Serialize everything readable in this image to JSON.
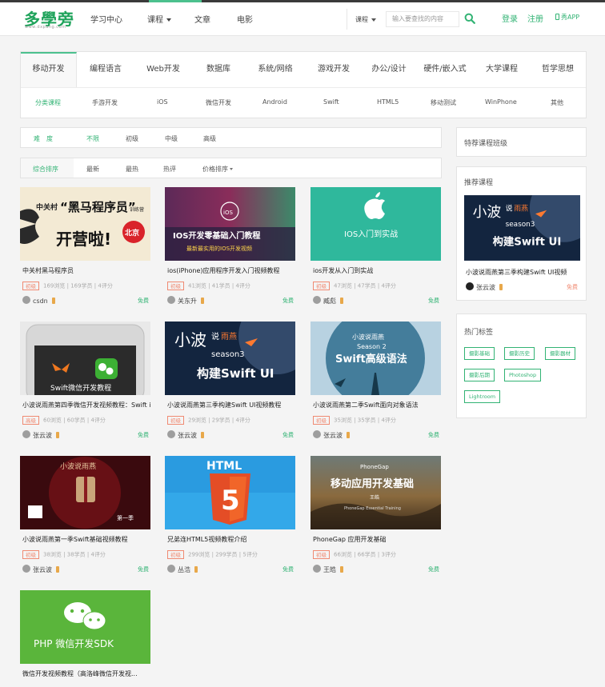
{
  "logo": {
    "text": "多學旁",
    "sub": "www.dxpang.com"
  },
  "nav": {
    "study": "学习中心",
    "course": "课程",
    "article": "文章",
    "movie": "电影"
  },
  "search": {
    "select": "课程",
    "placeholder": "输入要查找的内容"
  },
  "auth": {
    "login": "登录",
    "register": "注册",
    "app": "秀APP"
  },
  "categories": [
    "移动开发",
    "编程语言",
    "Web开发",
    "数据库",
    "系统/网络",
    "游戏开发",
    "办公/设计",
    "硬件/嵌入式",
    "大学课程",
    "哲学思想"
  ],
  "subcategories": [
    "分类课程",
    "手游开发",
    "iOS",
    "微信开发",
    "Android",
    "Swift",
    "HTML5",
    "移动测试",
    "WinPhone",
    "其他"
  ],
  "difficulty": {
    "label": "难　度",
    "options": [
      "不限",
      "初级",
      "中级",
      "高级"
    ]
  },
  "sorting": {
    "options": [
      "综合排序",
      "最新",
      "最热",
      "热评",
      "价格排序"
    ]
  },
  "courses": [
    {
      "title": "中关村黑马程序员",
      "level": "初级",
      "views": "169浏览",
      "students": "169学员",
      "ratings": "4评分",
      "author": "csdn",
      "price": "免费",
      "thumb": {
        "top": "中关村",
        "main": "“黑马程序员”",
        "tag": "训练营",
        "big": "开营啦!",
        "city": "北京"
      }
    },
    {
      "title": "ios(iPhone)应用程序开发入门视频教程",
      "level": "初级",
      "views": "41浏览",
      "students": "41学员",
      "ratings": "4评分",
      "author": "关东升",
      "price": "免费",
      "thumb": {
        "badge": "iOS",
        "main": "IOS开发零基础入门教程",
        "sub": "最新最实用的IOS开发视频"
      }
    },
    {
      "title": "ios开发从入门到实战",
      "level": "初级",
      "views": "47浏览",
      "students": "47学员",
      "ratings": "4评分",
      "author": "臧彪",
      "price": "免费",
      "thumb": {
        "main": "IOS入门到实战"
      }
    },
    {
      "title": "小波说雨燕第四季微信开发视频教程：Swift iP...",
      "level": "高级",
      "views": "60浏览",
      "students": "60学员",
      "ratings": "4评分",
      "author": "张云波",
      "price": "免费",
      "thumb": {
        "main": "Swift微信开发教程"
      }
    },
    {
      "title": "小波说雨燕第三季构建Swift UI视频教程",
      "level": "初级",
      "views": "29浏览",
      "students": "29学员",
      "ratings": "4评分",
      "author": "张云波",
      "price": "免费",
      "thumb": {
        "brand1": "小波",
        "brand2": "说",
        "brand3": "雨燕",
        "season": "season3",
        "main": "构建Swift UI"
      }
    },
    {
      "title": "小波说雨燕第二季Swift面向对象语法",
      "level": "初级",
      "views": "35浏览",
      "students": "35学员",
      "ratings": "4评分",
      "author": "张云波",
      "price": "免费",
      "thumb": {
        "top": "小波说雨燕",
        "season": "Season 2",
        "main": "Swift高级语法"
      }
    },
    {
      "title": "小波说雨燕第一季Swift基础视频教程",
      "level": "初级",
      "views": "38浏览",
      "students": "38学员",
      "ratings": "4评分",
      "author": "张云波",
      "price": "免费",
      "thumb": {
        "top": "小波说雨燕",
        "corner": "第一季"
      }
    },
    {
      "title": "兄弟连HTML5视频教程介绍",
      "level": "初级",
      "views": "299浏览",
      "students": "299学员",
      "ratings": "5评分",
      "author": "丛浩",
      "price": "免费",
      "thumb": {
        "top": "HTML",
        "num": "5"
      }
    },
    {
      "title": "PhoneGap 应用开发基础",
      "level": "初级",
      "views": "66浏览",
      "students": "66学员",
      "ratings": "3评分",
      "author": "王皓",
      "price": "免费",
      "thumb": {
        "top": "PhoneGap",
        "main": "移动应用开发基础",
        "author": "王皓",
        "sub": "PhoneGap Essential Training"
      }
    },
    {
      "title": "微信开发视频教程（高洛峰微信开发视...",
      "thumb": {
        "main": "PHP 微信开发SDK"
      }
    }
  ],
  "sidebar": {
    "featured_title": "特荐课程班级",
    "recommended_title": "推荐课程",
    "recommended": {
      "title": "小波说雨燕第三季构建Swift UI视频",
      "author": "张云波",
      "price": "免费",
      "thumb": {
        "brand1": "小波",
        "brand2": "说",
        "brand3": "雨燕",
        "season": "season3",
        "main": "构建Swift UI"
      }
    },
    "tags_title": "热门标签",
    "tags": [
      "摄影基础",
      "摄影历史",
      "摄影器材",
      "摄影后期",
      "Photoshop",
      "Lightroom"
    ]
  },
  "colors": {
    "accent": "#32b374",
    "badge": "#f08a72",
    "vip": "#e8a84a"
  }
}
